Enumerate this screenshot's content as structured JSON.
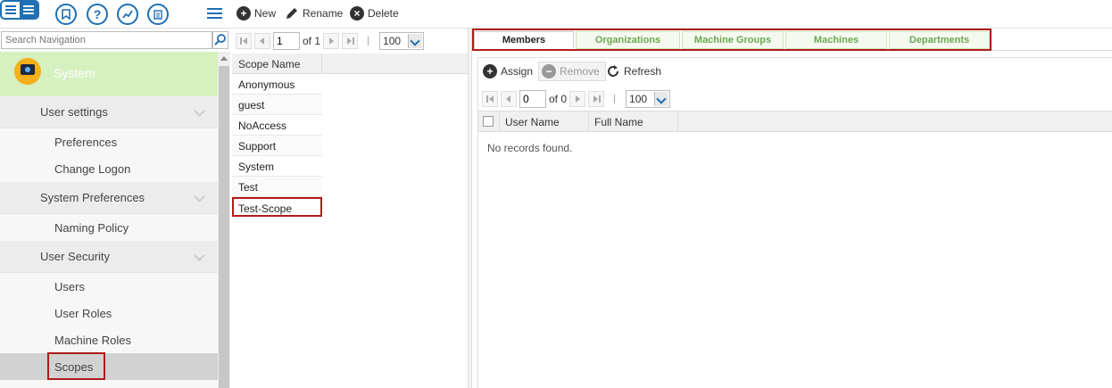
{
  "left_toolbar": {
    "icons": [
      "list-view-icon",
      "bookmark-icon",
      "help-icon",
      "trend-icon",
      "document-icon",
      "menu-icon"
    ]
  },
  "search": {
    "placeholder": "Search Navigation"
  },
  "navigation": {
    "module_title": "System",
    "groups": [
      {
        "label": "User settings",
        "items": [
          "Preferences",
          "Change Logon"
        ]
      },
      {
        "label": "System Preferences",
        "items": [
          "Naming Policy"
        ]
      },
      {
        "label": "User Security",
        "items": [
          "Users",
          "User Roles",
          "Machine Roles",
          "Scopes"
        ]
      }
    ],
    "selected_item": "Scopes"
  },
  "toolbar": {
    "new_label": "New",
    "rename_label": "Rename",
    "delete_label": "Delete"
  },
  "scopes_pager": {
    "page": "1",
    "of_label": "of 1",
    "page_size": "100"
  },
  "scopes_grid": {
    "column": "Scope Name",
    "rows": [
      "Anonymous",
      "guest",
      "NoAccess",
      "Support",
      "System",
      "Test",
      "Test-Scope"
    ],
    "selected_row": "Test-Scope"
  },
  "tabs": [
    "Members",
    "Organizations",
    "Machine Groups",
    "Machines",
    "Departments"
  ],
  "active_tab": "Members",
  "members": {
    "assign_label": "Assign",
    "remove_label": "Remove",
    "refresh_label": "Refresh",
    "pager": {
      "page": "0",
      "of_label": "of 0",
      "page_size": "100"
    },
    "columns": [
      "User Name",
      "Full Name"
    ],
    "empty_message": "No records found."
  },
  "colors": {
    "accent_blue": "#1f6fb2",
    "highlight_red": "#b01b1b",
    "tab_green": "#6aa84f",
    "module_header_green": "#d6f0c0"
  }
}
